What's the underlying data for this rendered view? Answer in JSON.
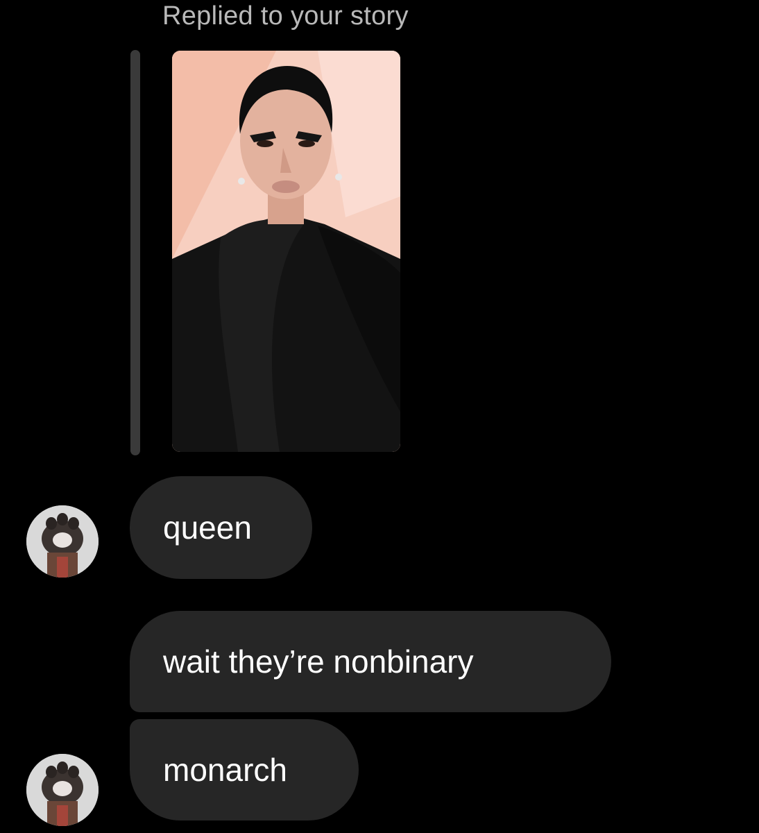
{
  "thread": {
    "reply_label": "Replied to your story"
  },
  "story": {
    "image_semantic": "story-photo",
    "background_color": "#f6c9ba"
  },
  "messages": [
    {
      "text": "queen",
      "sender": "other",
      "has_avatar": true
    },
    {
      "text": "wait they’re nonbinary",
      "sender": "other",
      "has_avatar": false
    },
    {
      "text": "monarch",
      "sender": "other",
      "has_avatar": true
    }
  ],
  "colors": {
    "background": "#000000",
    "bubble": "#262626",
    "reply_label": "#b9b9b9",
    "reply_bar": "#3a3a3a"
  }
}
